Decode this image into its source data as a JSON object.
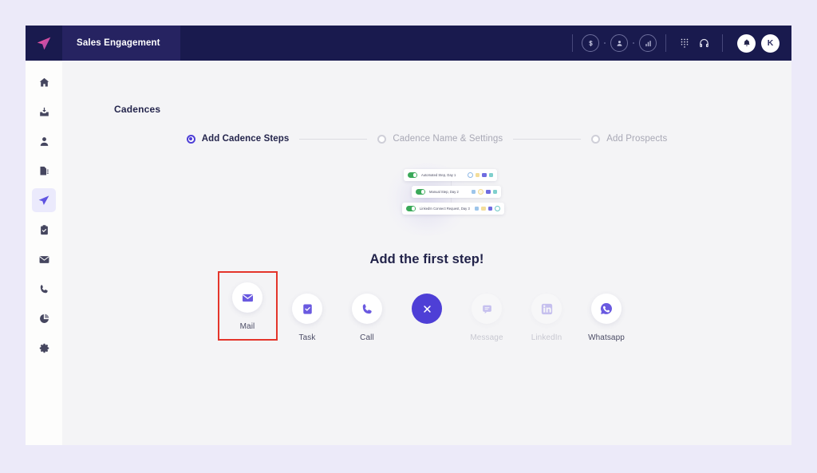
{
  "colors": {
    "page_background": "#eceaf9",
    "topbar": "#191a4e",
    "app_tab": "#262361",
    "accent": "#4e3fd6",
    "icon_purple": "#6a5ae0",
    "selection_outline": "#e4352b",
    "toggle_on": "#3aa959",
    "content_background": "#f4f4f6",
    "rail_background": "#fdfdfc",
    "rail_active_background": "#ebeafc"
  },
  "topbar": {
    "logo_icon": "paper-plane-icon",
    "app_tab_label": "Sales Engagement",
    "right_icons": [
      {
        "name": "dollar-circle-icon",
        "glyph": "$"
      },
      {
        "name": "person-circle-icon",
        "glyph": "♟"
      },
      {
        "name": "analytics-circle-icon",
        "glyph": "‖"
      }
    ],
    "actions": [
      {
        "name": "dialpad-icon"
      },
      {
        "name": "headset-icon"
      }
    ],
    "notification_icon": "bell-icon",
    "avatar_initial": "K"
  },
  "sidebar": {
    "items": [
      {
        "name": "sidebar-item-home",
        "icon": "home-icon",
        "active": false
      },
      {
        "name": "sidebar-item-inbox",
        "icon": "inbox-download-icon",
        "active": false
      },
      {
        "name": "sidebar-item-contacts",
        "icon": "person-icon",
        "active": false
      },
      {
        "name": "sidebar-item-reports",
        "icon": "document-list-icon",
        "active": false
      },
      {
        "name": "sidebar-item-cadences",
        "icon": "paper-plane-icon",
        "active": true
      },
      {
        "name": "sidebar-item-tasks",
        "icon": "clipboard-icon",
        "active": false
      },
      {
        "name": "sidebar-item-mail",
        "icon": "envelope-icon",
        "active": false
      },
      {
        "name": "sidebar-item-calls",
        "icon": "phone-icon",
        "active": false
      },
      {
        "name": "sidebar-item-analytics",
        "icon": "pie-chart-icon",
        "active": false
      },
      {
        "name": "sidebar-item-settings",
        "icon": "gear-icon",
        "active": false
      }
    ]
  },
  "main": {
    "page_title": "Cadences",
    "stepper": [
      {
        "label": "Add Cadence Steps",
        "active": true
      },
      {
        "label": "Cadence Name & Settings",
        "active": false
      },
      {
        "label": "Add Prospects",
        "active": false
      }
    ],
    "illustration_cards": [
      {
        "label": "Automated Step, Day 1",
        "toggle": "on"
      },
      {
        "label": "Manual Step, Day 2",
        "toggle": "on"
      },
      {
        "label": "LinkedIn Connect Request, Day 3",
        "toggle": "on"
      }
    ],
    "headline": "Add the first step!",
    "step_options": [
      {
        "label": "Mail",
        "icon": "envelope-icon",
        "selected": true,
        "disabled": false
      },
      {
        "label": "Task",
        "icon": "clipboard-check-icon",
        "selected": false,
        "disabled": false
      },
      {
        "label": "Call",
        "icon": "phone-icon",
        "selected": false,
        "disabled": false
      },
      {
        "label": "Message",
        "icon": "message-icon",
        "selected": false,
        "disabled": true
      },
      {
        "label": "LinkedIn",
        "icon": "linkedin-icon",
        "selected": false,
        "disabled": true
      },
      {
        "label": "Whatsapp",
        "icon": "whatsapp-icon",
        "selected": false,
        "disabled": false
      }
    ],
    "close_button": {
      "name": "close-button",
      "icon": "close-x-icon"
    }
  }
}
